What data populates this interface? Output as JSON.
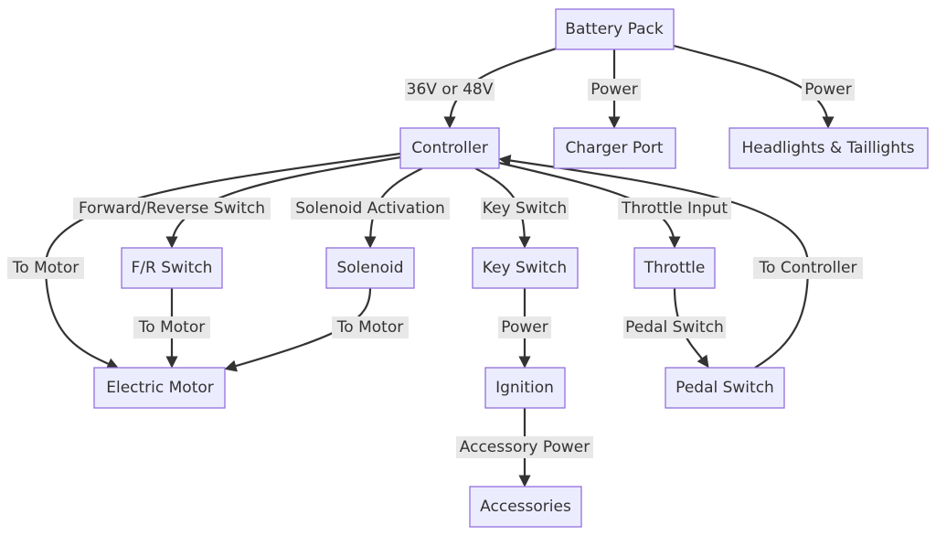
{
  "colors": {
    "node_fill": "#ECECFF",
    "node_border": "#9370DB",
    "edge": "#333333",
    "label_bg": "#e8e8e8",
    "text": "#333333"
  },
  "nodes": {
    "battery": "Battery Pack",
    "controller": "Controller",
    "charger": "Charger Port",
    "lights": "Headlights & Taillights",
    "fr_switch": "F/R Switch",
    "solenoid": "Solenoid",
    "key_switch": "Key Switch",
    "throttle": "Throttle",
    "motor": "Electric Motor",
    "ignition": "Ignition",
    "pedal": "Pedal Switch",
    "accessories": "Accessories"
  },
  "edges": [
    {
      "from": "Battery Pack",
      "to": "Controller",
      "label": "36V or 48V"
    },
    {
      "from": "Battery Pack",
      "to": "Charger Port",
      "label": "Power"
    },
    {
      "from": "Battery Pack",
      "to": "Headlights & Taillights",
      "label": "Power"
    },
    {
      "from": "Controller",
      "to": "F/R Switch",
      "label": "Forward/Reverse Switch"
    },
    {
      "from": "Controller",
      "to": "Solenoid",
      "label": "Solenoid Activation"
    },
    {
      "from": "Controller",
      "to": "Key Switch",
      "label": "Key Switch"
    },
    {
      "from": "Controller",
      "to": "Throttle",
      "label": "Throttle Input"
    },
    {
      "from": "Controller",
      "to": "Electric Motor",
      "label": "To Motor"
    },
    {
      "from": "Pedal Switch",
      "to": "Controller",
      "label": "To Controller"
    },
    {
      "from": "F/R Switch",
      "to": "Electric Motor",
      "label": "To Motor"
    },
    {
      "from": "Solenoid",
      "to": "Electric Motor",
      "label": "To Motor"
    },
    {
      "from": "Key Switch",
      "to": "Ignition",
      "label": "Power"
    },
    {
      "from": "Throttle",
      "to": "Pedal Switch",
      "label": "Pedal Switch"
    },
    {
      "from": "Ignition",
      "to": "Accessories",
      "label": "Accessory Power"
    }
  ]
}
